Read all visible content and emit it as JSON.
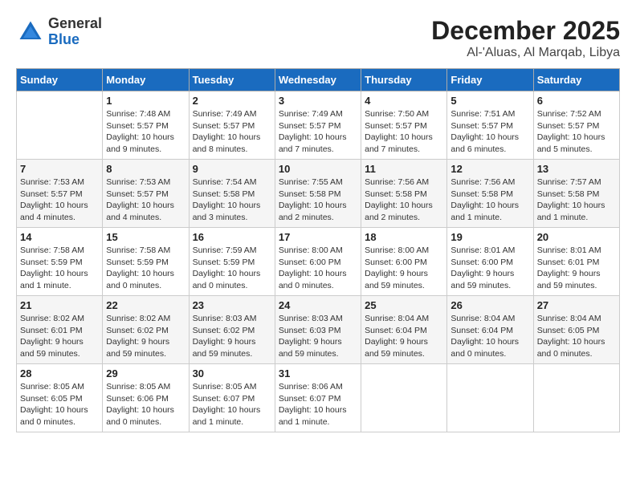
{
  "logo": {
    "general": "General",
    "blue": "Blue"
  },
  "title": "December 2025",
  "subtitle": "Al-'Aluas, Al Marqab, Libya",
  "days_of_week": [
    "Sunday",
    "Monday",
    "Tuesday",
    "Wednesday",
    "Thursday",
    "Friday",
    "Saturday"
  ],
  "weeks": [
    [
      {
        "day": "",
        "info": ""
      },
      {
        "day": "1",
        "info": "Sunrise: 7:48 AM\nSunset: 5:57 PM\nDaylight: 10 hours\nand 9 minutes."
      },
      {
        "day": "2",
        "info": "Sunrise: 7:49 AM\nSunset: 5:57 PM\nDaylight: 10 hours\nand 8 minutes."
      },
      {
        "day": "3",
        "info": "Sunrise: 7:49 AM\nSunset: 5:57 PM\nDaylight: 10 hours\nand 7 minutes."
      },
      {
        "day": "4",
        "info": "Sunrise: 7:50 AM\nSunset: 5:57 PM\nDaylight: 10 hours\nand 7 minutes."
      },
      {
        "day": "5",
        "info": "Sunrise: 7:51 AM\nSunset: 5:57 PM\nDaylight: 10 hours\nand 6 minutes."
      },
      {
        "day": "6",
        "info": "Sunrise: 7:52 AM\nSunset: 5:57 PM\nDaylight: 10 hours\nand 5 minutes."
      }
    ],
    [
      {
        "day": "7",
        "info": "Sunrise: 7:53 AM\nSunset: 5:57 PM\nDaylight: 10 hours\nand 4 minutes."
      },
      {
        "day": "8",
        "info": "Sunrise: 7:53 AM\nSunset: 5:57 PM\nDaylight: 10 hours\nand 4 minutes."
      },
      {
        "day": "9",
        "info": "Sunrise: 7:54 AM\nSunset: 5:58 PM\nDaylight: 10 hours\nand 3 minutes."
      },
      {
        "day": "10",
        "info": "Sunrise: 7:55 AM\nSunset: 5:58 PM\nDaylight: 10 hours\nand 2 minutes."
      },
      {
        "day": "11",
        "info": "Sunrise: 7:56 AM\nSunset: 5:58 PM\nDaylight: 10 hours\nand 2 minutes."
      },
      {
        "day": "12",
        "info": "Sunrise: 7:56 AM\nSunset: 5:58 PM\nDaylight: 10 hours\nand 1 minute."
      },
      {
        "day": "13",
        "info": "Sunrise: 7:57 AM\nSunset: 5:58 PM\nDaylight: 10 hours\nand 1 minute."
      }
    ],
    [
      {
        "day": "14",
        "info": "Sunrise: 7:58 AM\nSunset: 5:59 PM\nDaylight: 10 hours\nand 1 minute."
      },
      {
        "day": "15",
        "info": "Sunrise: 7:58 AM\nSunset: 5:59 PM\nDaylight: 10 hours\nand 0 minutes."
      },
      {
        "day": "16",
        "info": "Sunrise: 7:59 AM\nSunset: 5:59 PM\nDaylight: 10 hours\nand 0 minutes."
      },
      {
        "day": "17",
        "info": "Sunrise: 8:00 AM\nSunset: 6:00 PM\nDaylight: 10 hours\nand 0 minutes."
      },
      {
        "day": "18",
        "info": "Sunrise: 8:00 AM\nSunset: 6:00 PM\nDaylight: 9 hours\nand 59 minutes."
      },
      {
        "day": "19",
        "info": "Sunrise: 8:01 AM\nSunset: 6:00 PM\nDaylight: 9 hours\nand 59 minutes."
      },
      {
        "day": "20",
        "info": "Sunrise: 8:01 AM\nSunset: 6:01 PM\nDaylight: 9 hours\nand 59 minutes."
      }
    ],
    [
      {
        "day": "21",
        "info": "Sunrise: 8:02 AM\nSunset: 6:01 PM\nDaylight: 9 hours\nand 59 minutes."
      },
      {
        "day": "22",
        "info": "Sunrise: 8:02 AM\nSunset: 6:02 PM\nDaylight: 9 hours\nand 59 minutes."
      },
      {
        "day": "23",
        "info": "Sunrise: 8:03 AM\nSunset: 6:02 PM\nDaylight: 9 hours\nand 59 minutes."
      },
      {
        "day": "24",
        "info": "Sunrise: 8:03 AM\nSunset: 6:03 PM\nDaylight: 9 hours\nand 59 minutes."
      },
      {
        "day": "25",
        "info": "Sunrise: 8:04 AM\nSunset: 6:04 PM\nDaylight: 9 hours\nand 59 minutes."
      },
      {
        "day": "26",
        "info": "Sunrise: 8:04 AM\nSunset: 6:04 PM\nDaylight: 10 hours\nand 0 minutes."
      },
      {
        "day": "27",
        "info": "Sunrise: 8:04 AM\nSunset: 6:05 PM\nDaylight: 10 hours\nand 0 minutes."
      }
    ],
    [
      {
        "day": "28",
        "info": "Sunrise: 8:05 AM\nSunset: 6:05 PM\nDaylight: 10 hours\nand 0 minutes."
      },
      {
        "day": "29",
        "info": "Sunrise: 8:05 AM\nSunset: 6:06 PM\nDaylight: 10 hours\nand 0 minutes."
      },
      {
        "day": "30",
        "info": "Sunrise: 8:05 AM\nSunset: 6:07 PM\nDaylight: 10 hours\nand 1 minute."
      },
      {
        "day": "31",
        "info": "Sunrise: 8:06 AM\nSunset: 6:07 PM\nDaylight: 10 hours\nand 1 minute."
      },
      {
        "day": "",
        "info": ""
      },
      {
        "day": "",
        "info": ""
      },
      {
        "day": "",
        "info": ""
      }
    ]
  ]
}
